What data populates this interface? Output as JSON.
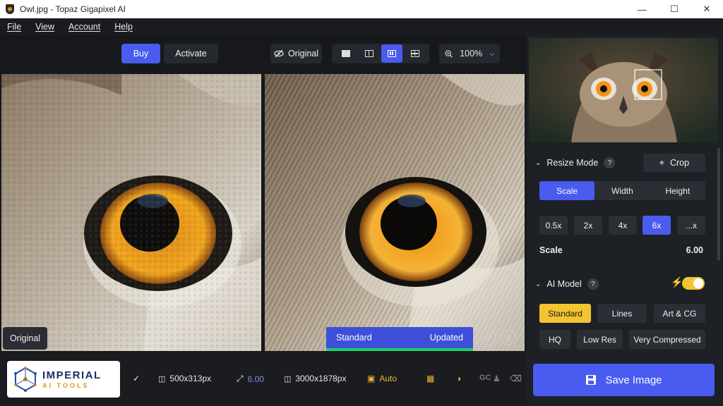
{
  "window": {
    "title": "Owl.jpg - Topaz Gigapixel AI",
    "minimize": "—",
    "maximize": "☐",
    "close": "✕"
  },
  "menu": [
    "File",
    "View",
    "Account",
    "Help"
  ],
  "toolbar": {
    "buy": "Buy",
    "activate": "Activate",
    "original": "Original",
    "zoom": "100%"
  },
  "viewer": {
    "original_label": "Original",
    "status_model": "Standard",
    "status_state": "Updated"
  },
  "bottom": {
    "logo_top": "IMPERIAL",
    "logo_bottom": "AI TOOLS",
    "source_size": "500x313px",
    "scale": "6.00",
    "output_size": "3000x1878px",
    "auto": "Auto",
    "gc": "GC"
  },
  "side": {
    "resize_mode": "Resize Mode",
    "crop": "Crop",
    "modes": [
      "Scale",
      "Width",
      "Height"
    ],
    "scales": [
      "0.5x",
      "2x",
      "4x",
      "6x",
      "...x"
    ],
    "scale_label": "Scale",
    "scale_value": "6.00",
    "ai_model": "AI Model",
    "models_row1": [
      "Standard",
      "Lines",
      "Art & CG"
    ],
    "models_row2": [
      "HQ",
      "Low Res",
      "Very Compressed"
    ],
    "save": "Save Image"
  },
  "colors": {
    "accent": "#4a5bf0",
    "gold": "#f4c430",
    "progress": "#1fcf6b"
  }
}
